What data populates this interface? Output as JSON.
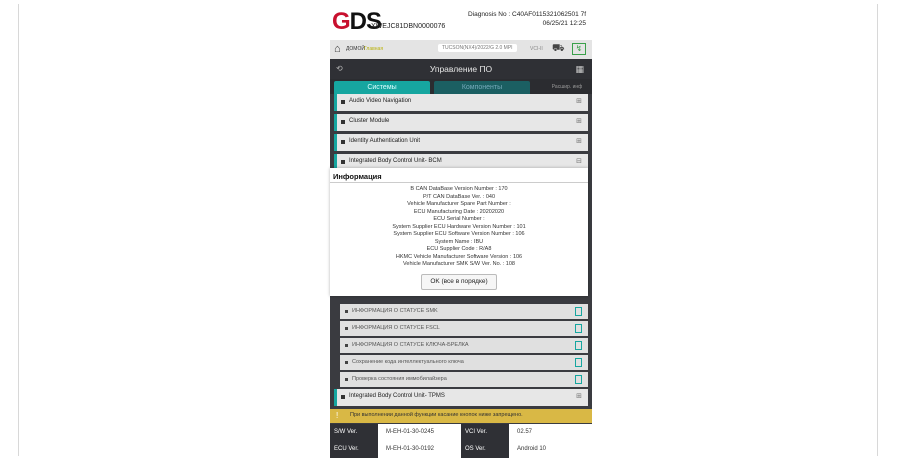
{
  "header": {
    "logo": "GDS",
    "vin": "XWEJC81DBN0000076",
    "diagnosis_no": "Diagnosis No : C40AF0115321062501 7f",
    "datetime": "06/25/21 12:25"
  },
  "topbar": {
    "home_label": "ДОМОЙ",
    "home_sub": "Главная",
    "vehicle": "TUCSON(NX4)/2022/G 2.0 MPI",
    "vci": "VCI-II"
  },
  "titlebar": {
    "title": "Управление ПО"
  },
  "tabs": {
    "systems": "Системы",
    "components": "Компоненты",
    "extended": "Расшир. инф"
  },
  "systems": [
    "Audio Video Navigation",
    "Cluster Module",
    "Identity Authentication Unit",
    "Integrated Body Control Unit- BCM"
  ],
  "subitems": [
    "ИНФОРМАЦИЯ О СТАТУСЕ SMK",
    "ИНФОРМАЦИЯ О СТАТУСЕ FSCL",
    "ИНФОРМАЦИЯ О СТАТУСЕ КЛЮЧА-БРЕЛКА",
    "Сохранение кода интеллектуального ключа",
    "Проверка состояния иммобилайзера"
  ],
  "system_after": "Integrated Body Control Unit- TPMS",
  "warning": "При выполнении данной функции касание кнопок ниже запрещено.",
  "info": {
    "sw_ver_label": "S/W Ver.",
    "sw_ver": "M-EH-01-30-0245",
    "vci_ver_label": "VCI Ver.",
    "vci_ver": "02.57",
    "ecu_ver_label": "ECU Ver.",
    "ecu_ver": "M-EH-01-30-0192",
    "os_ver_label": "OS Ver.",
    "os_ver": "Android 10"
  },
  "dialog": {
    "title": "Информация",
    "lines": [
      "B CAN DataBase Version Number : 170",
      "P/T CAN DataBase Ver. : 040",
      "Vehicle Manufacturer Spare Part Number :",
      "ECU Manufacturing Date : 20202020",
      "ECU Serial Number :",
      "System Supplier ECU Hardware Version Number : 101",
      "System Supplier ECU Software Version Number : 106",
      "System Name : IBU",
      "ECU Supplier Code : R/A8",
      "HKMC Vehicle Manufacturer Software Version : 106",
      "Vehicle Manufacturer SMK S/W Ver. No. : 108"
    ],
    "ok_label": "OK (все в порядке)"
  }
}
